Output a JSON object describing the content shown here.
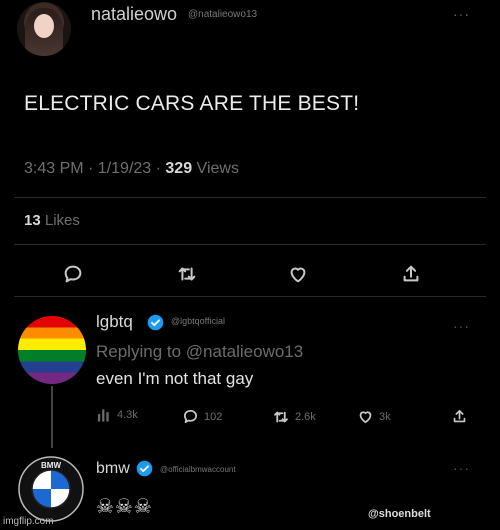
{
  "main_tweet": {
    "username": "natalieowo",
    "handle": "@natalieowo13",
    "more": "···",
    "text": "ELECTRIC CARS ARE THE BEST!",
    "time": "3:43 PM · 1/19/23 · ",
    "views_count": "329",
    "views_label": " Views",
    "likes_count": "13",
    "likes_label": " Likes",
    "actions": [
      "reply-icon",
      "retweet-icon",
      "like-icon",
      "share-icon"
    ]
  },
  "reply_lgbtq": {
    "name": "lgbtq",
    "handle": "@lgbtqofficial",
    "more": "···",
    "replying_to": "Replying to @natalieowo13",
    "text": "even I'm not that gay",
    "views": "4.3k",
    "replies": "102",
    "retweets": "2.6k",
    "likes": "3k"
  },
  "reply_bmw": {
    "name": "bmw",
    "handle": "@officialbmwaccount",
    "more": "···",
    "text": "☠☠☠",
    "logo_letters": "BMW"
  },
  "watermarks": {
    "left": "imgflip.com",
    "right": "@shoenbelt"
  },
  "colors": {
    "background": "#000000",
    "verified_badge": "#1d9bf0",
    "muted_text": "#6f6f6f"
  }
}
